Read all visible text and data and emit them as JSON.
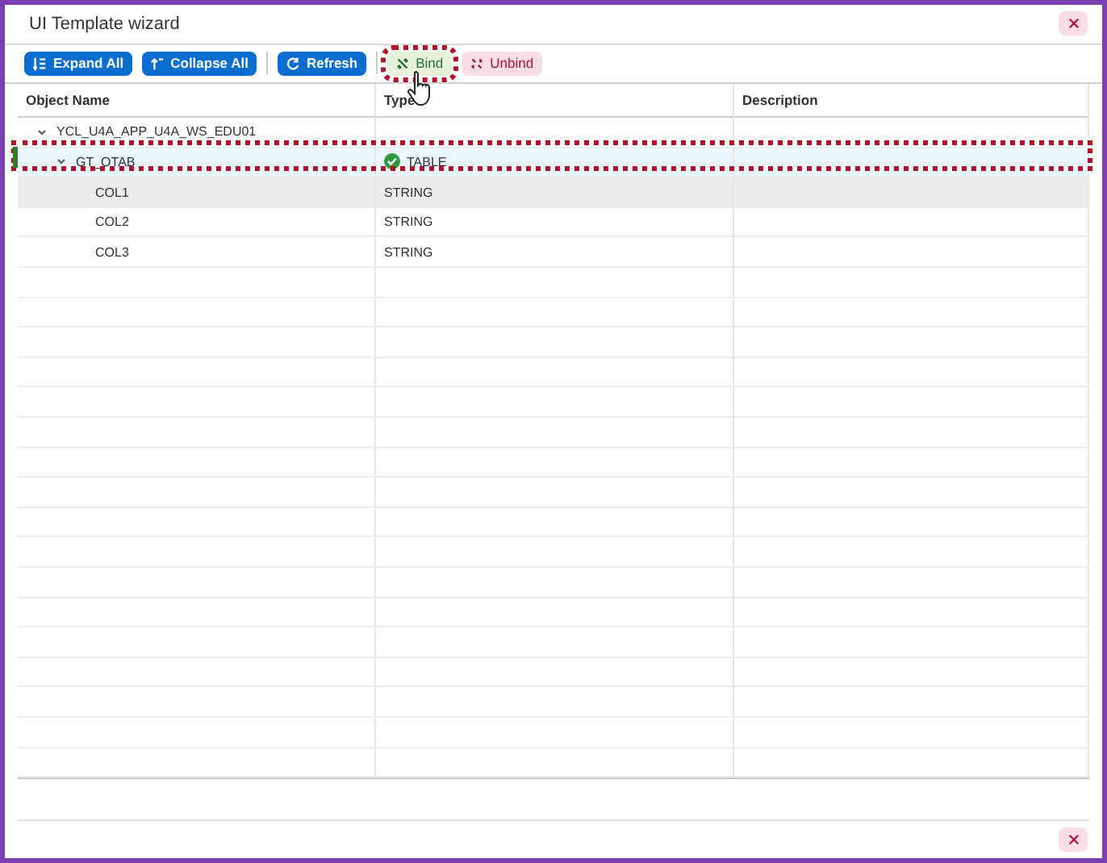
{
  "window": {
    "title": "UI Template wizard"
  },
  "toolbar": [
    {
      "label": "Expand All",
      "kind": "expand"
    },
    {
      "label": "Collapse All",
      "kind": "collapse"
    },
    {
      "label": "Refresh",
      "kind": "refresh"
    },
    {
      "label": "Bind",
      "kind": "bind",
      "highlighted": true
    },
    {
      "label": "Unbind",
      "kind": "unbind",
      "highlighted": false
    }
  ],
  "table": {
    "columns": [
      "Object Name",
      "Type",
      "Description"
    ],
    "rows": [
      {
        "name": "YCL_U4A_APP_U4A_WS_EDU01",
        "expanded": true,
        "selected": false,
        "children": [
          {
            "name": "GT_OTAB",
            "type": "TABLE",
            "expanded": true,
            "selected": true,
            "bound": true,
            "children": [
              {
                "name": "COL1",
                "type": "STRING",
                "selected": false,
                "hovered": true
              },
              {
                "name": "COL2",
                "type": "STRING",
                "selected": false
              },
              {
                "name": "COL3",
                "type": "STRING",
                "selected": false
              }
            ]
          }
        ]
      }
    ]
  }
}
